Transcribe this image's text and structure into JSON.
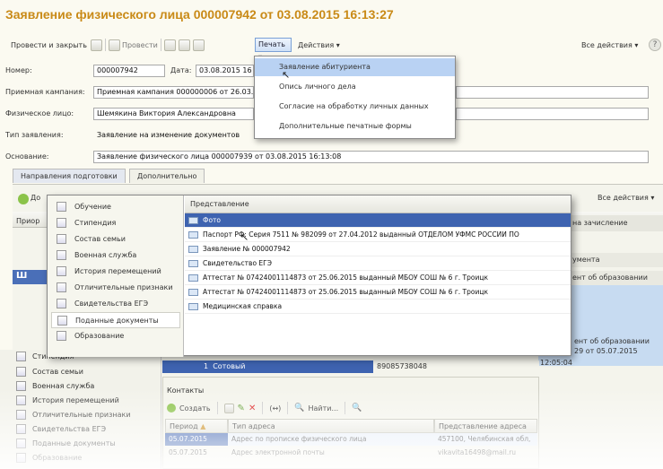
{
  "window": {
    "title": "Заявление физического лица 000007942 от 03.08.2015 16:13:27"
  },
  "toolbar": {
    "post_close": "Провести и закрыть",
    "post": "Провести",
    "print": "Печать",
    "actions": "Действия",
    "all_actions": "Все действия",
    "help": "?"
  },
  "print_menu": {
    "items": [
      "Заявление абитуриента",
      "Опись личного дела",
      "Согласие на обработку личных данных",
      "Дополнительные печатные формы"
    ]
  },
  "form": {
    "number_label": "Номер:",
    "number_value": "000007942",
    "date_label": "Дата:",
    "date_value": "03.08.2015 16",
    "campaign_label": "Приемная кампания:",
    "campaign_value": "Приемная кампания 000000006 от 26.03.",
    "person_label": "Физическое лицо:",
    "person_value": "Шемякина Виктория Александровна",
    "type_label": "Тип заявления:",
    "type_value": "Заявление на изменение документов",
    "basis_label": "Основание:",
    "basis_value": "Заявление физического лица 000007939 от 03.08.2015 16:13:08"
  },
  "tabs": [
    "Направления подготовки",
    "Дополнительно"
  ],
  "inner": {
    "all_actions": "Все действия",
    "prior_col": "Приор",
    "add_btn": "До",
    "side_texts": [
      "на зачисление",
      "ументa",
      "ент об образовании"
    ],
    "side_block": [
      "ент об образовании",
      "29 от 05.07.2015"
    ],
    "time": "12:05:04",
    "shi": "Ш"
  },
  "left_menu": {
    "items": [
      "Обучение",
      "Стипендия",
      "Состав семьи",
      "Военная служба",
      "История перемещений",
      "Отличительные признаки",
      "Свидетельства ЕГЭ",
      "Поданные документы",
      "Образование"
    ]
  },
  "docs_grid": {
    "header": "Представление",
    "rows": [
      "Фото",
      "Паспорт РФ: Серия  7511  №  982099  от  27.04.2012  выданный   ОТДЕЛОМ УФМС РОССИИ ПО",
      "Заявление   №  000007942",
      "Свидетельство ЕГЭ",
      "Аттестат   №  07424001114873  от  25.06.2015  выданный    МБОУ СОШ № 6 г. Троицк",
      "Аттестат   №  07424001114873  от  25.06.2015  выданный    МБОУ СОШ № 6 г. Троицк",
      "Медицинская справка"
    ]
  },
  "back_menu": {
    "top_label": "Стипендия",
    "items": [
      "Состав семьи",
      "Военная служба",
      "История перемещений",
      "Отличительные признаки",
      "Свидетельства ЕГЭ",
      "Поданные документы",
      "Образование"
    ]
  },
  "phone_row": {
    "num": "1",
    "type": "Сотовый",
    "value": "89085738048"
  },
  "contacts": {
    "title": "Контакты",
    "create": "Создать",
    "find": "Найти...",
    "headers": [
      "Период",
      "Тип адреса",
      "Представление адреса"
    ],
    "rows": [
      [
        "05.07.2015",
        "Адрес по прописке физического лица",
        "457100, Челябинская обл,"
      ],
      [
        "05.07.2015",
        "Адрес электронной почты",
        "vikavita16498@mail.ru"
      ]
    ]
  },
  "colors": {
    "title": "#c98a17",
    "selection": "#3e63b0",
    "menu_highlight": "#b9d2f3"
  }
}
